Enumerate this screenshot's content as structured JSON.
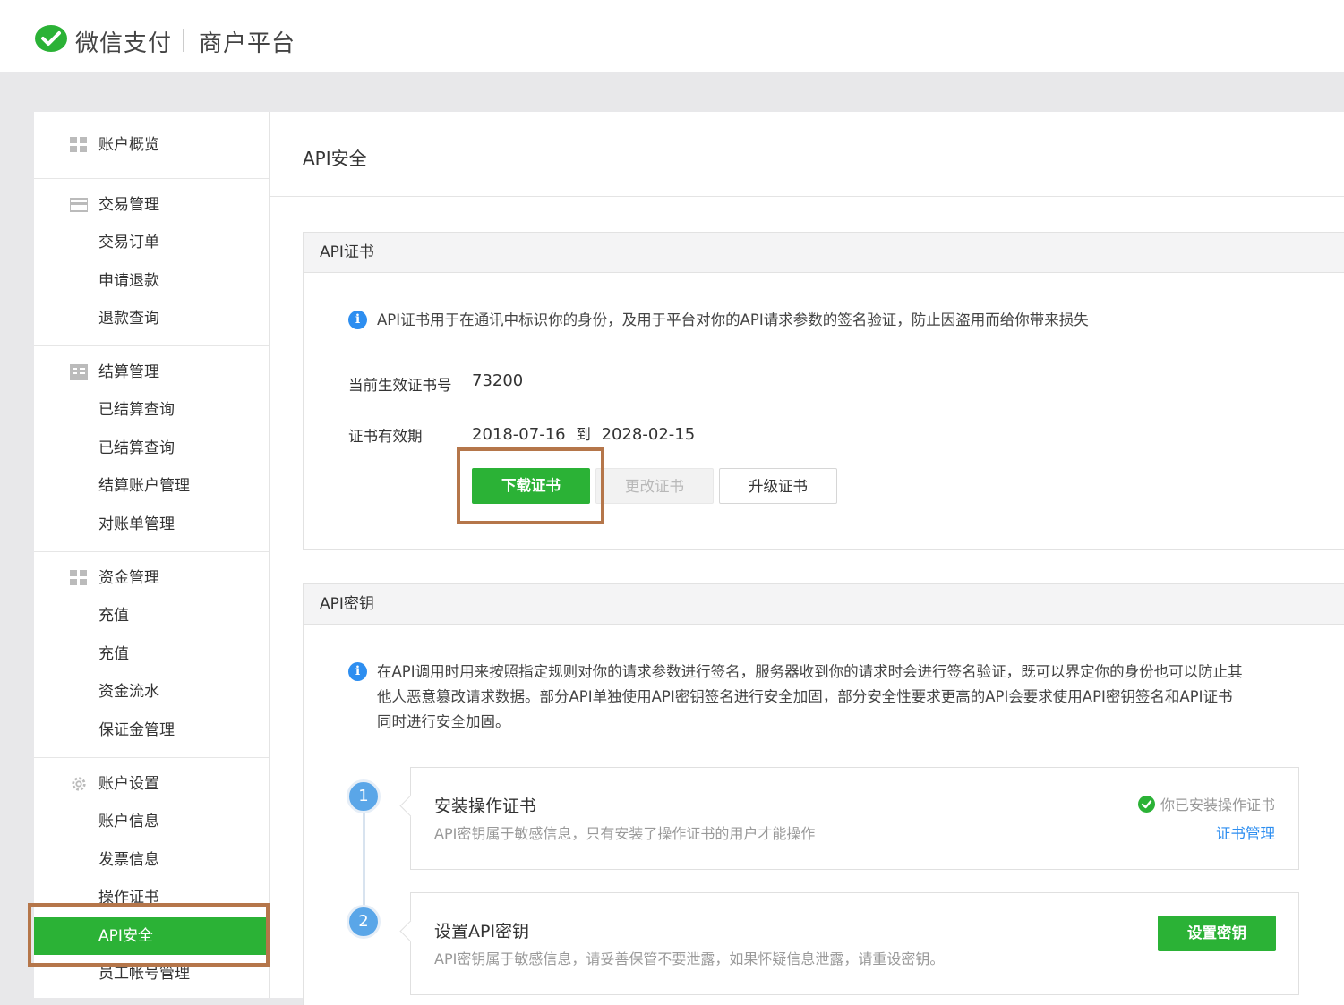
{
  "header": {
    "brand": "微信支付",
    "platform": "商户平台"
  },
  "sidebar": {
    "groups": [
      {
        "label": "账户概览",
        "icon": "grid-icon",
        "items": []
      },
      {
        "label": "交易管理",
        "icon": "card-icon",
        "items": [
          "交易订单",
          "申请退款",
          "退款查询"
        ]
      },
      {
        "label": "结算管理",
        "icon": "ledger-icon",
        "items": [
          "已结算查询",
          "已结算查询",
          "结算账户管理",
          "对账单管理"
        ]
      },
      {
        "label": "资金管理",
        "icon": "grid-icon",
        "items": [
          "充值",
          "充值",
          "资金流水",
          "保证金管理"
        ]
      },
      {
        "label": "账户设置",
        "icon": "gear-icon",
        "items": [
          "账户信息",
          "发票信息",
          "操作证书",
          "API安全",
          "员工帐号管理"
        ]
      }
    ],
    "active_item": "API安全"
  },
  "main": {
    "page_title": "API安全",
    "cert_panel": {
      "title": "API证书",
      "info": "API证书用于在通讯中标识你的身份，及用于平台对你的API请求参数的签名验证，防止因盗用而给你带来损失",
      "cert_no_label": "当前生效证书号",
      "cert_no": "73200",
      "validity_label": "证书有效期",
      "validity_from": "2018-07-16",
      "validity_to_word": "到",
      "validity_to": "2028-02-15",
      "buttons": {
        "download": "下载证书",
        "change": "更改证书",
        "upgrade": "升级证书"
      }
    },
    "key_panel": {
      "title": "API密钥",
      "info_lines": [
        "在API调用时用来按照指定规则对你的请求参数进行签名，服务器收到你的请求时会进行签名验证，既可以界定你的身份也可以防止其",
        "他人恶意篡改请求数据。部分API单独使用API密钥签名进行安全加固，部分安全性要求更高的API会要求使用API密钥签名和API证书",
        "同时进行安全加固。"
      ],
      "steps": [
        {
          "num": "1",
          "title": "安装操作证书",
          "desc": "API密钥属于敏感信息，只有安装了操作证书的用户才能操作",
          "status": "你已安装操作证书",
          "link": "证书管理"
        },
        {
          "num": "2",
          "title": "设置API密钥",
          "desc": "API密钥属于敏感信息，请妥善保管不要泄露，如果怀疑信息泄露，请重设密钥。",
          "button": "设置密钥"
        }
      ]
    }
  },
  "colors": {
    "accent": "#2bb236",
    "link": "#2d8ef0",
    "highlight": "#b5764a"
  }
}
